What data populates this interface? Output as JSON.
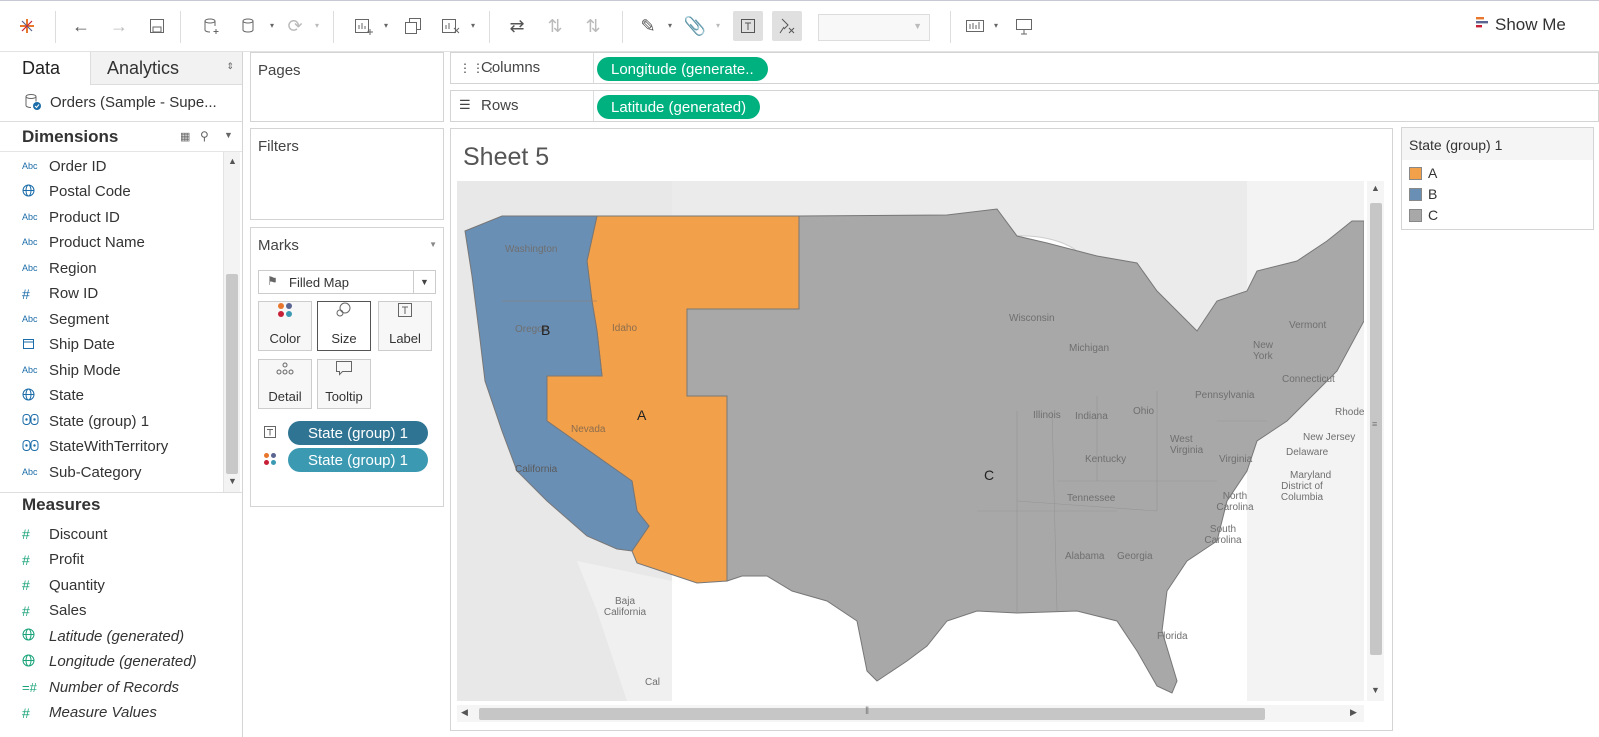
{
  "toolbar": {
    "show_me_label": "Show Me"
  },
  "data_pane": {
    "tab_data": "Data",
    "tab_analytics": "Analytics",
    "data_source": "Orders (Sample - Supe...",
    "dimensions_header": "Dimensions",
    "dimensions": [
      {
        "icon": "Abc",
        "name": "Order ID"
      },
      {
        "icon": "globe",
        "name": "Postal Code"
      },
      {
        "icon": "Abc",
        "name": "Product ID"
      },
      {
        "icon": "Abc",
        "name": "Product Name"
      },
      {
        "icon": "Abc",
        "name": "Region"
      },
      {
        "icon": "#",
        "name": "Row ID"
      },
      {
        "icon": "Abc",
        "name": "Segment"
      },
      {
        "icon": "calendar",
        "name": "Ship Date"
      },
      {
        "icon": "Abc",
        "name": "Ship Mode"
      },
      {
        "icon": "globe",
        "name": "State"
      },
      {
        "icon": "group",
        "name": "State (group) 1"
      },
      {
        "icon": "group",
        "name": "StateWithTerritory"
      },
      {
        "icon": "Abc",
        "name": "Sub-Category"
      }
    ],
    "measures_header": "Measures",
    "measures": [
      {
        "icon": "#",
        "name": "Discount",
        "italic": false
      },
      {
        "icon": "#",
        "name": "Profit",
        "italic": false
      },
      {
        "icon": "#",
        "name": "Quantity",
        "italic": false
      },
      {
        "icon": "#",
        "name": "Sales",
        "italic": false
      },
      {
        "icon": "globe",
        "name": "Latitude (generated)",
        "italic": true
      },
      {
        "icon": "globe",
        "name": "Longitude (generated)",
        "italic": true
      },
      {
        "icon": "=#",
        "name": "Number of Records",
        "italic": true
      },
      {
        "icon": "#",
        "name": "Measure Values",
        "italic": true
      }
    ]
  },
  "pages_card": {
    "title": "Pages"
  },
  "filters_card": {
    "title": "Filters"
  },
  "marks_card": {
    "title": "Marks",
    "mark_type": "Filled Map",
    "buttons": [
      "Color",
      "Size",
      "Label",
      "Detail",
      "Tooltip"
    ],
    "pills": [
      "State (group) 1",
      "State (group) 1"
    ]
  },
  "shelves": {
    "columns_label": "Columns",
    "columns_pill": "Longitude (generate..",
    "rows_label": "Rows",
    "rows_pill": "Latitude (generated)"
  },
  "sheet": {
    "title": "Sheet 5"
  },
  "map": {
    "region_labels": {
      "A": "A",
      "B": "B",
      "C": "C"
    },
    "base_labels": [
      "Washington",
      "Oregon",
      "Idaho",
      "Nevada",
      "California",
      "Baja California",
      "Cal",
      "Michigan",
      "Ohio",
      "Indiana",
      "Illinois",
      "Kentucky",
      "Tennessee",
      "West Virginia",
      "Virginia",
      "Pennsylvania",
      "New York",
      "Vermont",
      "Connecticut",
      "Rhode",
      "New Jersey",
      "Delaware",
      "Maryland",
      "District of Columbia",
      "North Carolina",
      "South Carolina",
      "Alabama",
      "Georgia",
      "Florida",
      "Wisconsin"
    ],
    "group_colors": {
      "A": "#f2a04a",
      "B": "#6a8fb5",
      "C": "#a8a8a8"
    }
  },
  "legend": {
    "title": "State (group) 1",
    "items": [
      {
        "label": "A",
        "color": "#f2a04a"
      },
      {
        "label": "B",
        "color": "#6a8fb5"
      },
      {
        "label": "C",
        "color": "#a8a8a8"
      }
    ]
  }
}
